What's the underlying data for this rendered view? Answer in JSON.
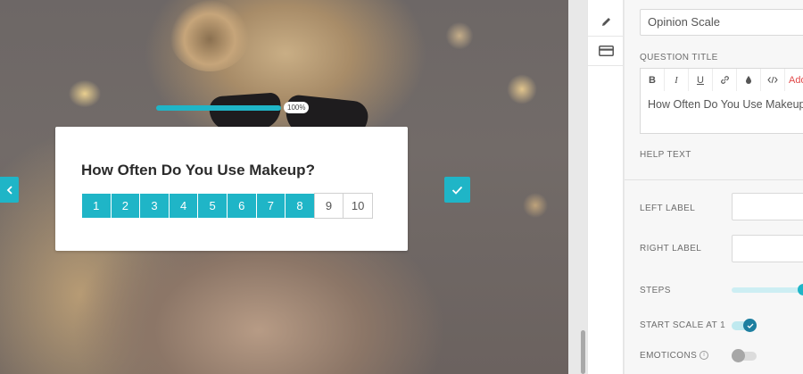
{
  "preview": {
    "progress_label": "100%",
    "question_title": "How Often Do You Use Makeup?",
    "scale": [
      {
        "label": "1",
        "selected": true
      },
      {
        "label": "2",
        "selected": true
      },
      {
        "label": "3",
        "selected": true
      },
      {
        "label": "4",
        "selected": true
      },
      {
        "label": "5",
        "selected": true
      },
      {
        "label": "6",
        "selected": true
      },
      {
        "label": "7",
        "selected": true
      },
      {
        "label": "8",
        "selected": true
      },
      {
        "label": "9",
        "selected": false
      },
      {
        "label": "10",
        "selected": false
      }
    ],
    "progress": 1.0
  },
  "tools": [
    {
      "icon": "pencil-icon"
    },
    {
      "icon": "card-icon"
    }
  ],
  "panel": {
    "type_value": "Opinion Scale",
    "question_title_label": "QUESTION TITLE",
    "editor": {
      "bold": "B",
      "italic": "I",
      "underline": "U",
      "add_label": "Add",
      "text": "How Often Do You Use Makeup?"
    },
    "help_text_label": "HELP TEXT",
    "left_label": "LEFT LABEL",
    "right_label": "RIGHT LABEL",
    "steps_label": "STEPS",
    "steps_value": 10,
    "start_scale_label": "START SCALE AT 1",
    "start_scale_on": true,
    "emoticons_label": "EMOTICONS",
    "emoticons_on": false
  },
  "colors": {
    "accent": "#1fb5c7",
    "toggle_on": "#1d7fa0"
  }
}
